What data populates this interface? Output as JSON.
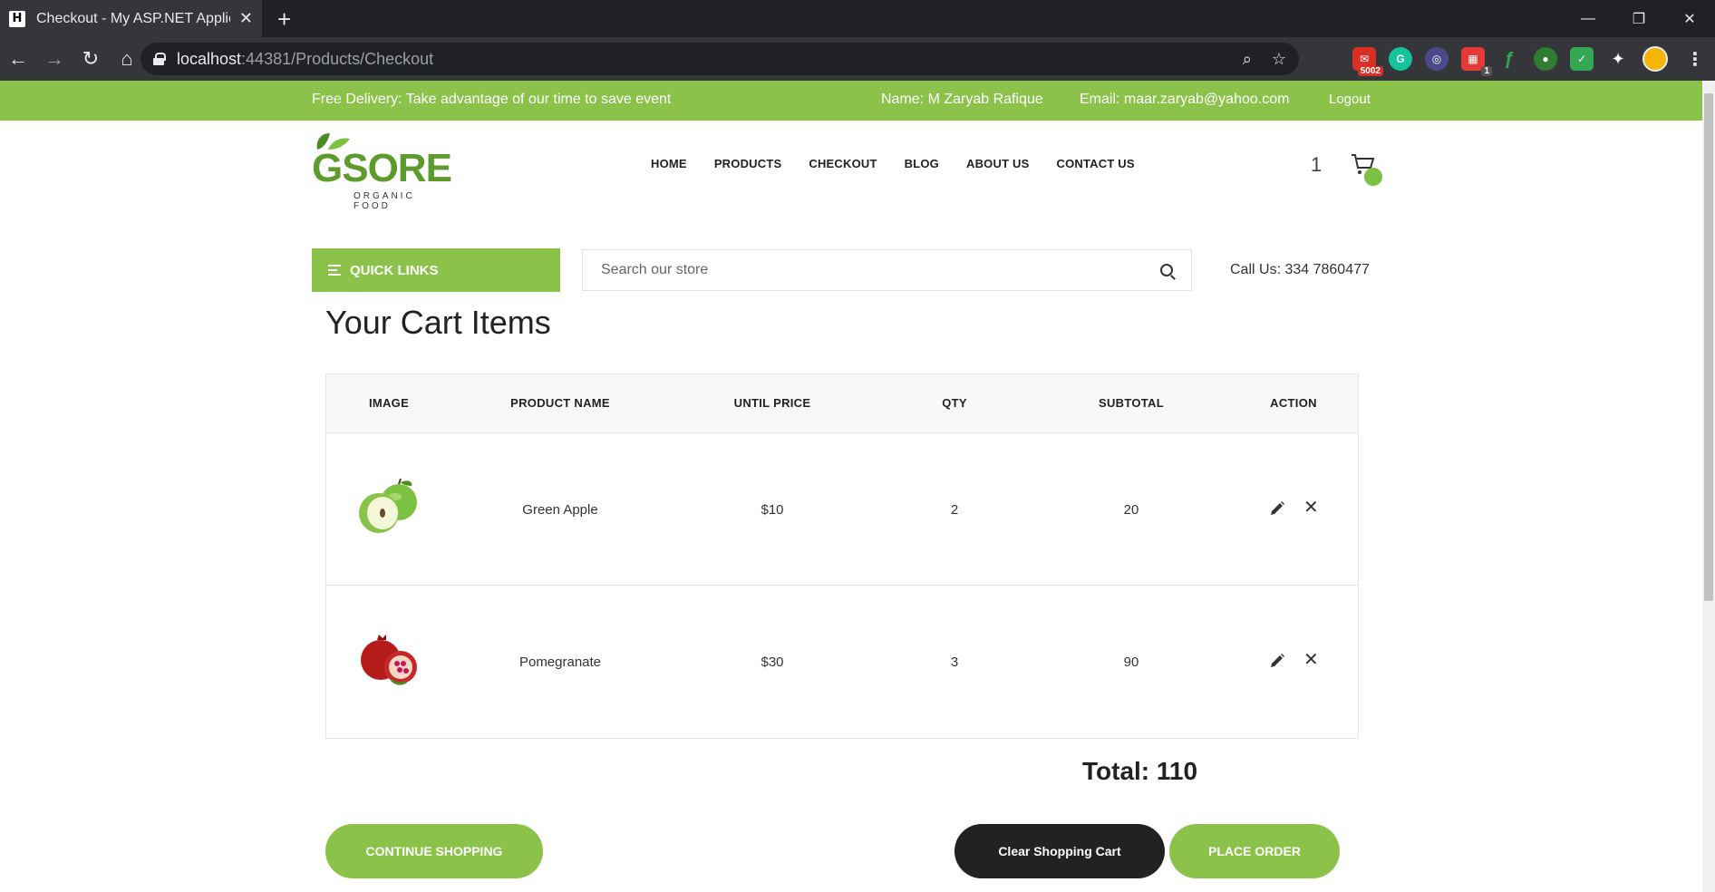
{
  "browser": {
    "tab_title": "Checkout - My ASP.NET Applicati",
    "tab_favicon_letter": "H",
    "url_host": "localhost",
    "url_rest": ":44381/Products/Checkout",
    "ext_mail_badge": "5002",
    "ext_calendar_badge": "1"
  },
  "topbar": {
    "promo": "Free Delivery: Take advantage of our time to save event",
    "name": "Name: M Zaryab Rafique",
    "email": "Email: maar.zaryab@yahoo.com",
    "logout": "Logout"
  },
  "logo": {
    "text": "GSORE",
    "subtitle": "ORGANIC FOOD"
  },
  "nav": {
    "home": "HOME",
    "products": "PRODUCTS",
    "checkout": "CHECKOUT",
    "blog": "BLOG",
    "about": "ABOUT US",
    "contact": "CONTACT US"
  },
  "cart": {
    "count": "1"
  },
  "toolbar": {
    "quick_links": "QUICK LINKS",
    "search_placeholder": "Search our store",
    "call_us": "Call Us: 334 7860477"
  },
  "page": {
    "title": "Your Cart Items"
  },
  "table": {
    "headers": {
      "image": "IMAGE",
      "product_name": "PRODUCT NAME",
      "unit_price": "UNTIL PRICE",
      "qty": "QTY",
      "subtotal": "SUBTOTAL",
      "action": "ACTION"
    },
    "rows": [
      {
        "name": "Green Apple",
        "price": "$10",
        "qty": "2",
        "subtotal": "20"
      },
      {
        "name": "Pomegranate",
        "price": "$30",
        "qty": "3",
        "subtotal": "90"
      }
    ]
  },
  "summary": {
    "total": "Total: 110"
  },
  "buttons": {
    "continue": "CONTINUE SHOPPING",
    "clear": "Clear Shopping Cart",
    "order": "PLACE ORDER"
  },
  "colors": {
    "brand_green": "#8bc34a",
    "dark_button": "#222222"
  }
}
